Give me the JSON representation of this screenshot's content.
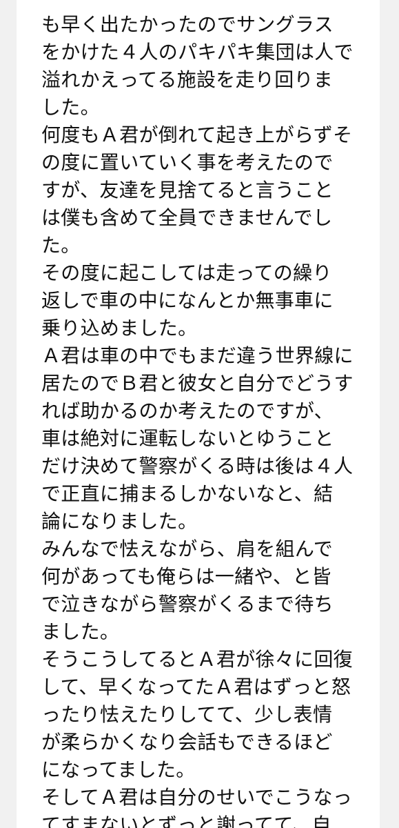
{
  "message": {
    "lines": [
      "も早く出たかったのでサングラス",
      "をかけた４人のパキパキ集団は人で",
      "溢れかえってる施設を走り回りま",
      "した。",
      "何度もＡ君が倒れて起き上がらずそ",
      "の度に置いていく事を考えたので",
      "すが、友達を見捨てると言うこと",
      "は僕も含めて全員できませんでし",
      "た。",
      "その度に起こしては走っての繰り",
      "返しで車の中になんとか無事車に",
      "乗り込めました。",
      "Ａ君は車の中でもまだ違う世界線に",
      "居たのでＢ君と彼女と自分でどうす",
      "れば助かるのか考えたのですが、",
      "車は絶対に運転しないとゆうこと",
      "だけ決めて警察がくる時は後は４人",
      "で正直に捕まるしかないなと、結",
      "論になりました。",
      "みんなで怯えながら、肩を組んで",
      "何があっても俺らは一緒や、と皆",
      "で泣きながら警察がくるまで待ち",
      "ました。",
      "そうこうしてるとＡ君が徐々に回復",
      "して、早くなってたＡ君はずっと怒",
      "ったり怯えたりしてて、少し表情",
      "が柔らかくなり会話もできるほど",
      "になってました。",
      "そしてＡ君は自分のせいでこうなっ",
      "てすまないとずっと謝ってて、自"
    ]
  }
}
